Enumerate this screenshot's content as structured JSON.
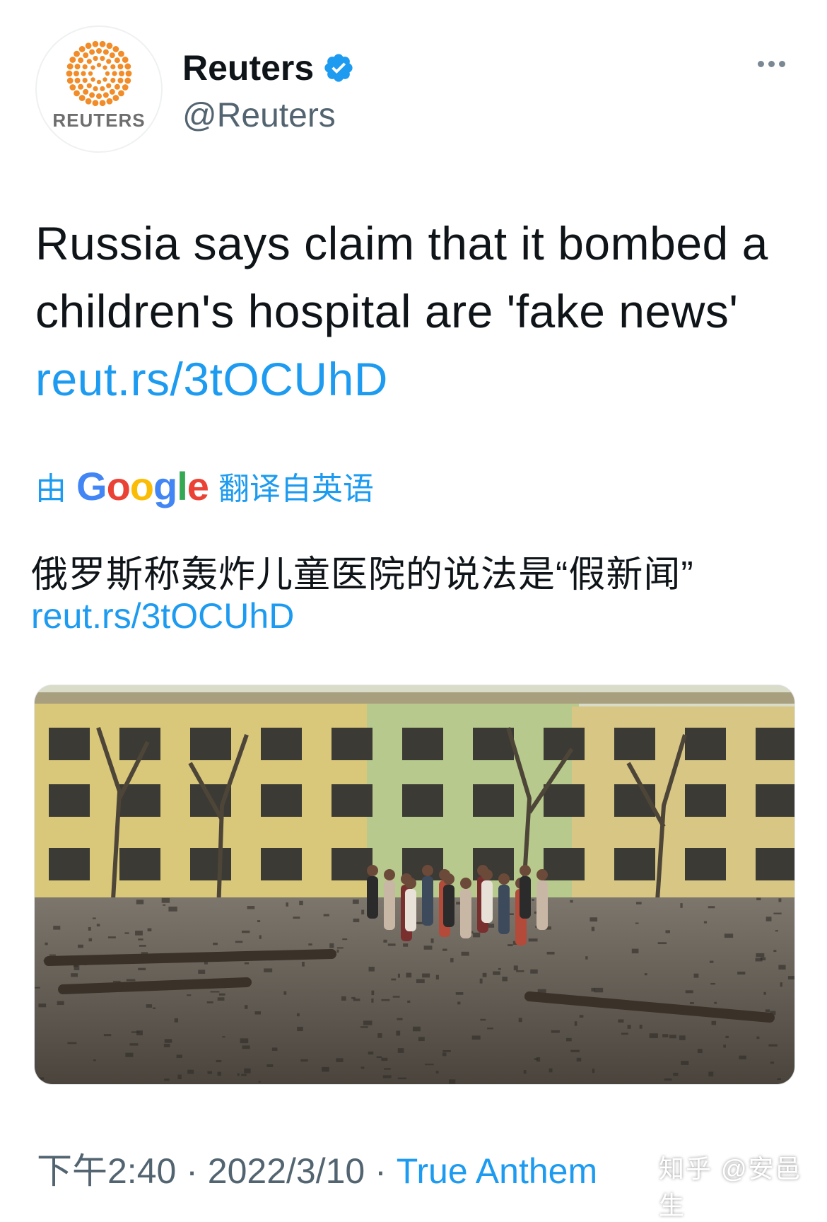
{
  "colors": {
    "link": "#1d9bf0",
    "secondary_text": "#536471",
    "verified": "#1d9bf0"
  },
  "author": {
    "logo_word": "REUTERS",
    "display_name": "Reuters",
    "handle": "@Reuters",
    "verified_icon": "verified-badge-icon"
  },
  "more_icon": "ellipsis-icon",
  "tweet": {
    "text": "Russia says claim that it bombed a children's hospital are 'fake news'",
    "link": "reut.rs/3tOCUhD"
  },
  "translation": {
    "prefix": "由",
    "brand": "Google",
    "suffix": "翻译自英语",
    "text": "俄罗斯称轰炸儿童医院的说法是“假新闻”",
    "link": "reut.rs/3tOCUhD"
  },
  "media": {
    "icon": "photo-icon"
  },
  "meta": {
    "time": "下午2:40",
    "separator": "·",
    "date": "2022/3/10",
    "source": "True Anthem"
  },
  "watermark": "知乎 @安邑生"
}
